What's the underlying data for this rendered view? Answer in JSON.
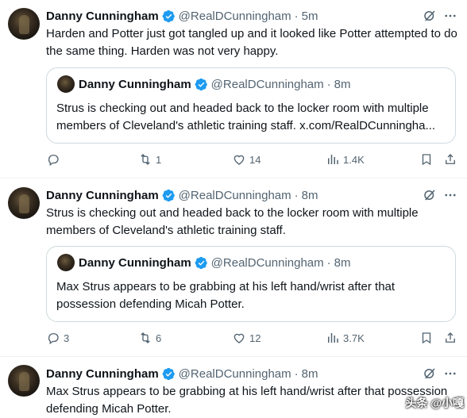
{
  "author": {
    "name": "Danny Cunningham",
    "handle": "@RealDCunningham"
  },
  "tweets": [
    {
      "time": "5m",
      "text": "Harden and Potter just got tangled up and it looked like Potter attempted to do the same thing. Harden was not very happy.",
      "quote": {
        "name": "Danny Cunningham",
        "handle": "@RealDCunningham",
        "time": "8m",
        "text": "Strus is checking out and headed back to the locker room with multiple members of Cleveland's athletic training staff. x.com/RealDCunningha..."
      },
      "replies": "",
      "retweets": "1",
      "likes": "14",
      "views": "1.4K"
    },
    {
      "time": "8m",
      "text": "Strus is checking out and headed back to the locker room with multiple members of Cleveland's athletic training staff.",
      "quote": {
        "name": "Danny Cunningham",
        "handle": "@RealDCunningham",
        "time": "8m",
        "text": "Max Strus appears to be grabbing at his left hand/wrist after that possession defending Micah Potter."
      },
      "replies": "3",
      "retweets": "6",
      "likes": "12",
      "views": "3.7K"
    },
    {
      "time": "8m",
      "text": "Max Strus appears to be grabbing at his left hand/wrist after that possession defending Micah Potter."
    }
  ],
  "separator": "·",
  "watermark": "头条 @小嘎"
}
